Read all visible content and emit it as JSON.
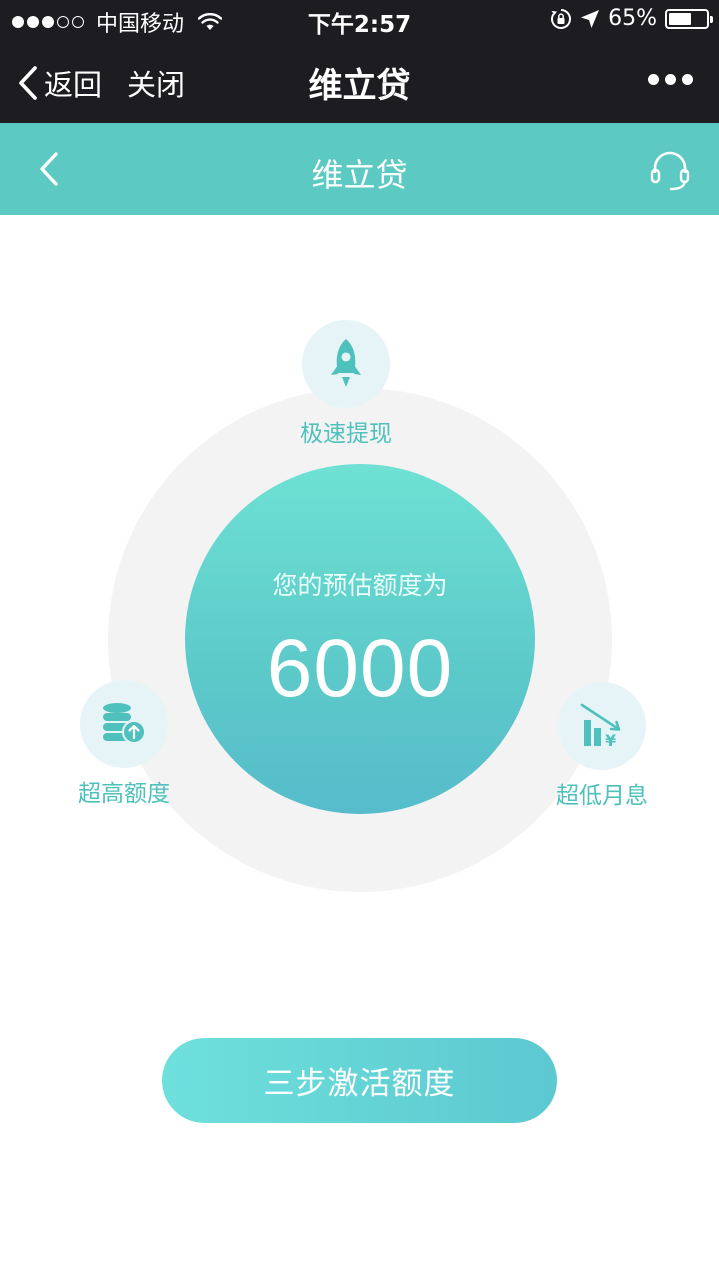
{
  "status_bar": {
    "carrier": "中国移动",
    "time": "下午2:57",
    "battery_percent": "65%",
    "battery_level": 0.65
  },
  "wechat_nav": {
    "back_label": "返回",
    "close_label": "关闭",
    "title": "维立贷"
  },
  "app_header": {
    "title": "维立贷"
  },
  "estimate": {
    "label": "您的预估额度为",
    "amount": "6000"
  },
  "features": [
    {
      "label": "极速提现",
      "icon": "rocket-icon"
    },
    {
      "label": "超高额度",
      "icon": "coin-stack-icon"
    },
    {
      "label": "超低月息",
      "icon": "falling-chart-icon"
    }
  ],
  "activate_button": {
    "label": "三步激活额度"
  },
  "colors": {
    "accent": "#5ccac2",
    "dark_bar": "#1d1d21",
    "feature_text": "#4fc1bc"
  }
}
